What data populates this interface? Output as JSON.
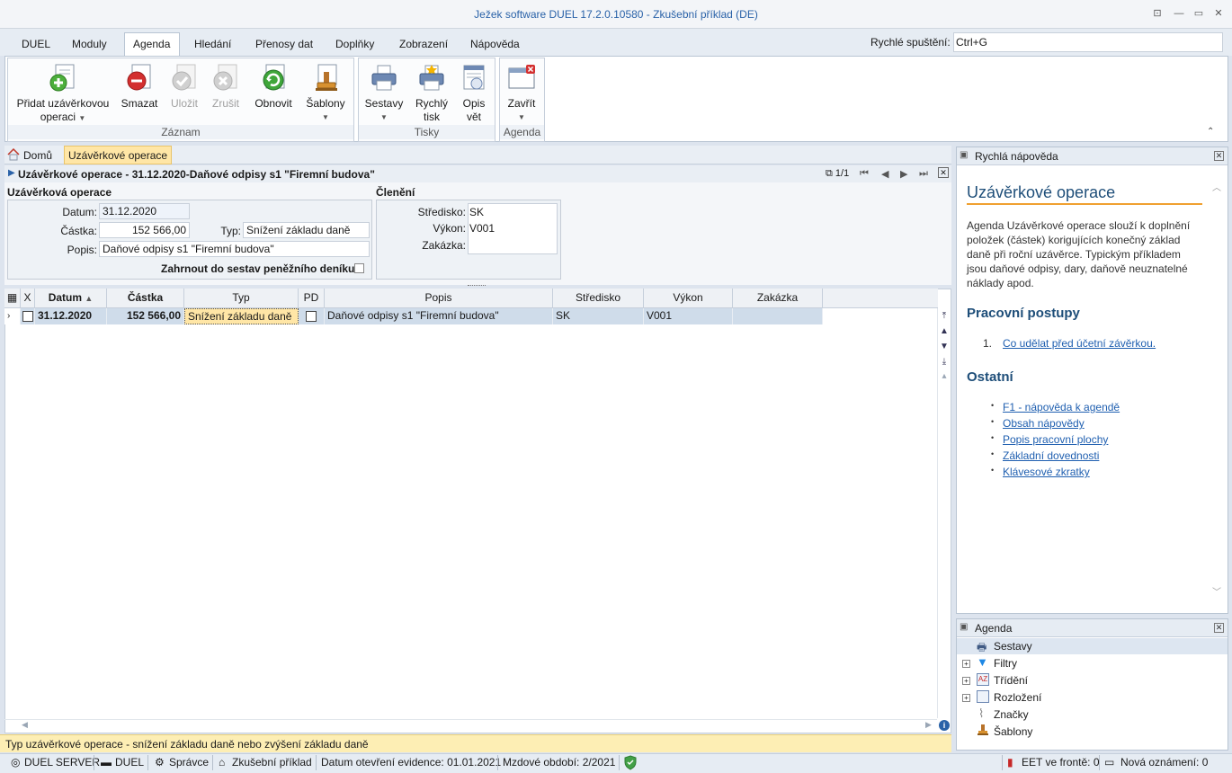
{
  "window": {
    "title": "Ježek software DUEL 17.2.0.10580 - Zkušební příklad (DE)"
  },
  "menu": {
    "items": [
      "DUEL",
      "Moduly",
      "Agenda",
      "Hledání",
      "Přenosy dat",
      "Doplňky",
      "Zobrazení",
      "Nápověda"
    ],
    "active": "Agenda",
    "quick_label": "Rychlé spuštění:",
    "quick_value": "Ctrl+G"
  },
  "ribbon": {
    "groups": {
      "zaznam": "Záznam",
      "tisky": "Tisky",
      "agenda": "Agenda"
    },
    "buttons": {
      "add_line1": "Přidat uzávěrkovou",
      "add_line2": "operaci",
      "delete": "Smazat",
      "save": "Uložit",
      "cancel": "Zrušit",
      "refresh": "Obnovit",
      "templates": "Šablony",
      "reports": "Sestavy",
      "quick_print_line1": "Rychlý",
      "quick_print_line2": "tisk",
      "copy_line1": "Opis",
      "copy_line2": "vět",
      "close": "Zavřít"
    }
  },
  "breadcrumb": {
    "home": "Domů",
    "current": "Uzávěrkové operace"
  },
  "record": {
    "header": "Uzávěrkové operace - 31.12.2020-Daňové odpisy s1 \"Firemní budova\"",
    "pager": "1/1"
  },
  "form": {
    "section_main": "Uzávěrková operace",
    "section_split": "Členění",
    "date_label": "Datum:",
    "date_value": "31.12.2020",
    "amount_label": "Částka:",
    "amount_value": "152 566,00",
    "type_label": "Typ:",
    "type_value": "Snížení základu daně",
    "desc_label": "Popis:",
    "desc_value": "Daňové odpisy s1 \"Firemní budova\"",
    "include_label": "Zahrnout do sestav peněžního deníku:",
    "center_label": "Středisko:",
    "center_value": "SK",
    "output_label": "Výkon:",
    "output_value": "V001",
    "order_label": "Zakázka:",
    "order_value": ""
  },
  "grid": {
    "columns": [
      "X",
      "Datum",
      "Částka",
      "Typ",
      "PD",
      "Popis",
      "Středisko",
      "Výkon",
      "Zakázka"
    ],
    "rows": [
      {
        "date": "31.12.2020",
        "amount": "152 566,00",
        "type": "Snížení základu daně",
        "desc": "Daňové odpisy s1 \"Firemní budova\"",
        "center": "SK",
        "output": "V001",
        "order": ""
      }
    ]
  },
  "hint": "Typ uzávěrkové operace - snížení základu daně nebo zvýšení základu daně",
  "help": {
    "panel_title": "Rychlá nápověda",
    "title": "Uzávěrkové operace",
    "text": "Agenda Uzávěrkové operace slouží k doplnění položek (částek) korigujících konečný základ daně při roční uzávěrce. Typickým příkladem jsou daňové odpisy, dary, daňově neuznatelné náklady apod.",
    "procedures_title": "Pracovní postupy",
    "procedures": [
      "Co udělat před účetní závěrkou."
    ],
    "other_title": "Ostatní",
    "other_links": [
      "F1 - nápověda k agendě",
      "Obsah nápovědy",
      "Popis pracovní plochy",
      "Základní dovednosti",
      "Klávesové zkratky"
    ]
  },
  "agenda_panel": {
    "title": "Agenda",
    "items": [
      "Sestavy",
      "Filtry",
      "Třídění",
      "Rozložení",
      "Značky",
      "Šablony"
    ]
  },
  "status": {
    "server": "DUEL SERVER",
    "app": "DUEL",
    "user": "Správce",
    "company": "Zkušební příklad",
    "opened": "Datum otevření evidence: 01.01.2021",
    "payroll": "Mzdové období: 2/2021",
    "eet": "EET ve frontě: 0",
    "notices": "Nová oznámení: 0"
  },
  "colors": {
    "accent": "#2a62a8",
    "selection": "#cfdcea",
    "highlight": "#ffe6a6"
  }
}
